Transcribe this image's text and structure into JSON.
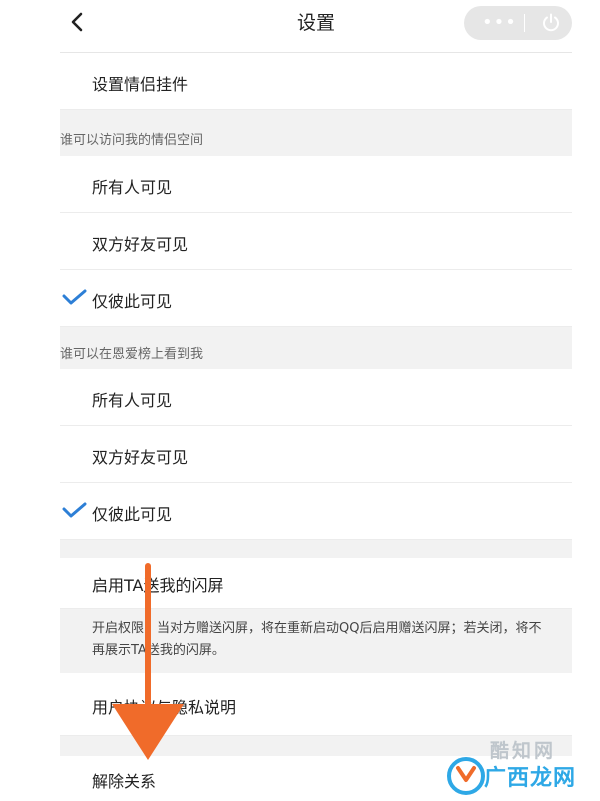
{
  "header": {
    "title": "设置",
    "back_icon": "chevron-left-icon",
    "more_icon": "more-dots-icon",
    "more_glyph": "•••",
    "power_icon": "power-icon"
  },
  "rows": {
    "couple_widget": "设置情侣挂件",
    "space_all": "所有人可见",
    "space_mutual": "双方好友可见",
    "space_only": "仅彼此可见",
    "rank_all": "所有人可见",
    "rank_mutual": "双方好友可见",
    "rank_only": "仅彼此可见",
    "flash_screen": "启用TA送我的闪屏",
    "agreement": "用户协议与隐私说明",
    "unbind": "解除关系"
  },
  "sections": {
    "space_visibility": "谁可以访问我的情侣空间",
    "rank_visibility": "谁可以在恩爱榜上看到我"
  },
  "notes": {
    "flash_screen_desc": "开启权限，当对方赠送闪屏，将在重新启动QQ后启用赠送闪屏；若关闭，将不再展示TA送我的闪屏。"
  },
  "watermark": {
    "top": "酷知网",
    "bottom": "广西龙网"
  },
  "colors": {
    "accent_check": "#2d7fd6",
    "overlay_arrow": "#f06b2a",
    "section_bg": "#f2f2f2"
  }
}
